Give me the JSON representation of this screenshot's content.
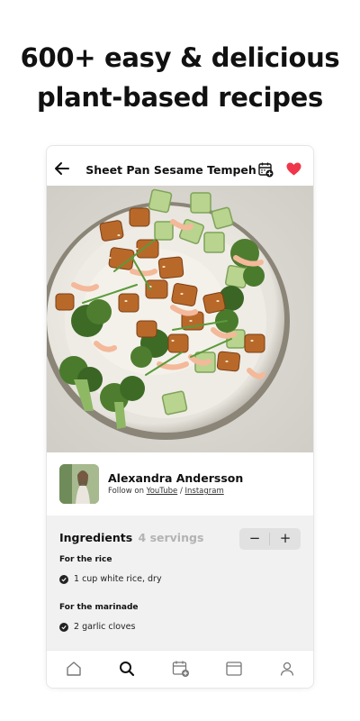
{
  "headline": {
    "line1": "600+ easy & delicious",
    "line2": "plant-based recipes"
  },
  "recipe": {
    "title": "Sheet Pan Sesame Tempeh",
    "favorited": true,
    "accent_color": "#f0364b"
  },
  "author": {
    "name": "Alexandra Andersson",
    "follow_prefix": "Follow on",
    "link1": "YouTube",
    "separator": "/",
    "link2": "Instagram"
  },
  "ingredients": {
    "title": "Ingredients",
    "servings": "4 servings",
    "stepper_minus": "−",
    "stepper_plus": "+",
    "sections": [
      {
        "label": "For the rice",
        "items": [
          "1 cup white rice, dry"
        ]
      },
      {
        "label": "For the marinade",
        "items": [
          "2 garlic cloves"
        ]
      }
    ]
  },
  "tabbar": {
    "icons": [
      "home-icon",
      "search-icon",
      "meal-plan-icon",
      "calendar-icon",
      "profile-icon"
    ],
    "active": "search-icon"
  }
}
